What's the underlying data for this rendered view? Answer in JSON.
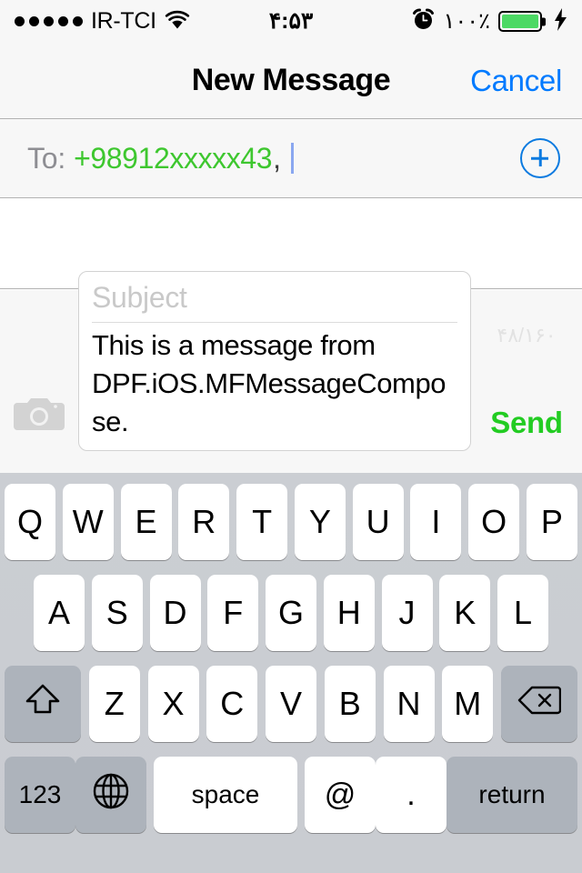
{
  "status_bar": {
    "signal_dots_filled": 5,
    "signal_dots_total": 5,
    "carrier": "IR-TCI",
    "wifi_icon": "wifi-icon",
    "time": "۴:۵۳",
    "alarm_icon": "alarm-clock-icon",
    "battery_percent": "۱۰۰٪",
    "battery_level": 100,
    "charging_icon": "lightning-bolt-icon",
    "battery_color": "#4cd964"
  },
  "nav_bar": {
    "title": "New Message",
    "cancel_label": "Cancel",
    "cancel_color": "#007aff"
  },
  "to_field": {
    "label": "To:",
    "recipient": "+98912xxxxx43",
    "separator": ",",
    "recipient_color": "#3ec72f",
    "add_contact_icon": "plus-circle-icon"
  },
  "compose": {
    "camera_icon": "camera-icon",
    "subject_placeholder": "Subject",
    "body_text": "This is a message from DPF.iOS.MFMessageCompose.",
    "char_counter": "۴۸/۱۶۰",
    "send_label": "Send",
    "send_color": "#22cc22"
  },
  "keyboard": {
    "row1": [
      "Q",
      "W",
      "E",
      "R",
      "T",
      "Y",
      "U",
      "I",
      "O",
      "P"
    ],
    "row2": [
      "A",
      "S",
      "D",
      "F",
      "G",
      "H",
      "J",
      "K",
      "L"
    ],
    "row3_letters": [
      "Z",
      "X",
      "C",
      "V",
      "B",
      "N",
      "M"
    ],
    "shift_icon": "shift-arrow-icon",
    "backspace_icon": "backspace-delete-icon",
    "numbers_label": "123",
    "globe_icon": "globe-language-icon",
    "space_label": "space",
    "at_label": "@",
    "period_label": ".",
    "return_label": "return"
  }
}
